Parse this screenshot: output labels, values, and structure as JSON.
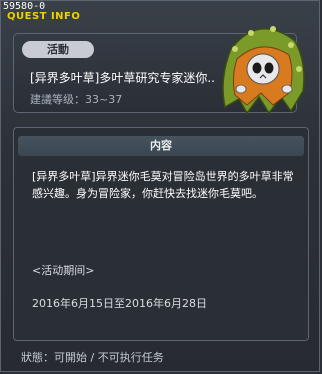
{
  "window": {
    "id_label": "59580-0",
    "title": "QUEST INFO"
  },
  "summary": {
    "type_badge": "活動",
    "quest_name": "[异界多叶草]多叶草研究专家迷你..",
    "level_label": "建議等级：33~37"
  },
  "content": {
    "header": "内容",
    "body": "[异界多叶草]异界迷你毛莫对冒险岛世界的多叶草非常感兴趣。身为冒险家，你赶快去找迷你毛莫吧。",
    "period_label": "<活动期间>",
    "period_dates": "2016年6月15日至2016年6月28日"
  },
  "status": {
    "text": "狀態：可開始 / 不可执行任务"
  },
  "colors": {
    "title_yellow": "#f0d000",
    "panel_bg": "#2a2e35",
    "badge_bg": "#c8ccd2",
    "npc_hood_green": "#7a9a2a",
    "npc_hood_orange": "#d87a20"
  },
  "icons": {
    "npc": "leaf-hooded-skull-npc-icon"
  }
}
